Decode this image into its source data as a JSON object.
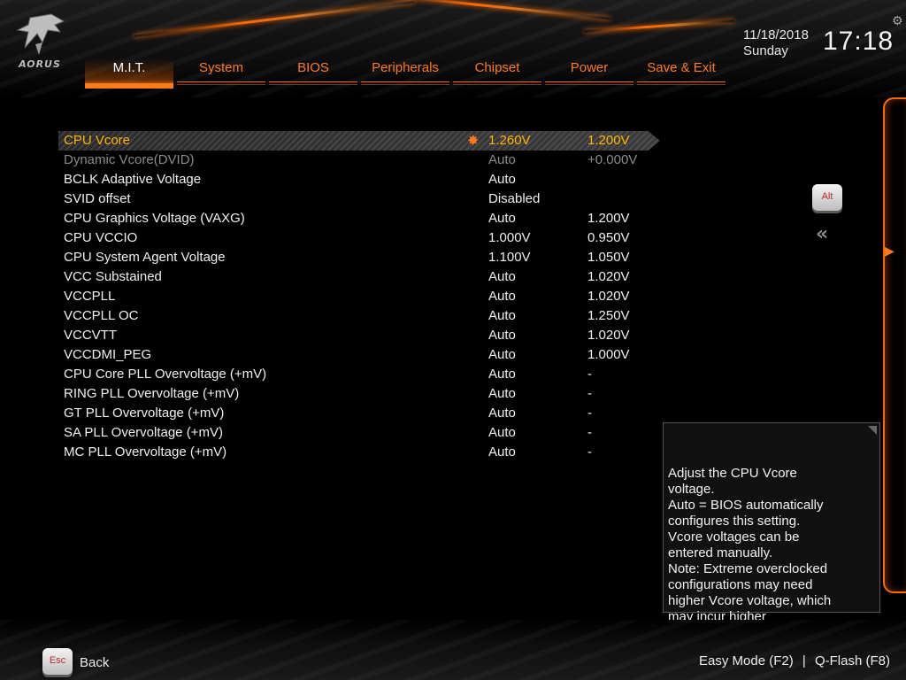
{
  "brand": {
    "logo_text": "AORUS",
    "logo_icon": "aorus-eagle-icon",
    "accent": "#ff6a00"
  },
  "header": {
    "date": "11/18/2018",
    "day": "Sunday",
    "time": "17:18",
    "settings_icon": "gear-icon"
  },
  "tabs": [
    {
      "label": "M.I.T.",
      "active": true
    },
    {
      "label": "System"
    },
    {
      "label": "BIOS"
    },
    {
      "label": "Peripherals"
    },
    {
      "label": "Chipset"
    },
    {
      "label": "Power"
    },
    {
      "label": "Save & Exit"
    }
  ],
  "settings": [
    {
      "label": "CPU Vcore",
      "value": "1.260V",
      "current": "1.200V",
      "selected": true,
      "starred": true
    },
    {
      "label": "Dynamic Vcore(DVID)",
      "value": "Auto",
      "current": "+0.000V",
      "disabled": true
    },
    {
      "label": "BCLK Adaptive Voltage",
      "value": "Auto",
      "current": ""
    },
    {
      "label": "SVID offset",
      "value": "Disabled",
      "current": ""
    },
    {
      "label": "CPU Graphics Voltage (VAXG)",
      "value": "Auto",
      "current": "1.200V"
    },
    {
      "label": "CPU VCCIO",
      "value": "1.000V",
      "current": "0.950V"
    },
    {
      "label": "CPU System Agent Voltage",
      "value": "1.100V",
      "current": "1.050V"
    },
    {
      "label": "VCC Substained",
      "value": "Auto",
      "current": "1.020V"
    },
    {
      "label": "VCCPLL",
      "value": "Auto",
      "current": "1.020V"
    },
    {
      "label": "VCCPLL OC",
      "value": "Auto",
      "current": "1.250V"
    },
    {
      "label": "VCCVTT",
      "value": "Auto",
      "current": "1.020V"
    },
    {
      "label": "VCCDMI_PEG",
      "value": "Auto",
      "current": "1.000V"
    },
    {
      "label": "CPU Core PLL Overvoltage (+mV)",
      "value": "Auto",
      "current": "-"
    },
    {
      "label": "RING PLL Overvoltage (+mV)",
      "value": "Auto",
      "current": "-"
    },
    {
      "label": "GT PLL Overvoltage (+mV)",
      "value": "Auto",
      "current": "-"
    },
    {
      "label": "SA PLL Overvoltage (+mV)",
      "value": "Auto",
      "current": "-"
    },
    {
      "label": "MC PLL Overvoltage (+mV)",
      "value": "Auto",
      "current": "-"
    }
  ],
  "alt_key": {
    "label": "Alt"
  },
  "collapse_icon": "double-chevron-left-icon",
  "help": {
    "text": "Adjust the CPU Vcore\nvoltage.\nAuto = BIOS automatically\nconfigures this setting.\nVcore voltages can be\nentered manually.\nNote: Extreme overclocked\nconfigurations may need\nhigher Vcore voltage, which\nmay incur higher\ntemperatures."
  },
  "footer": {
    "esc_key": "Esc",
    "back_label": "Back",
    "easy_mode": "Easy Mode (F2)",
    "separator": "|",
    "qflash": "Q-Flash (F8)"
  }
}
